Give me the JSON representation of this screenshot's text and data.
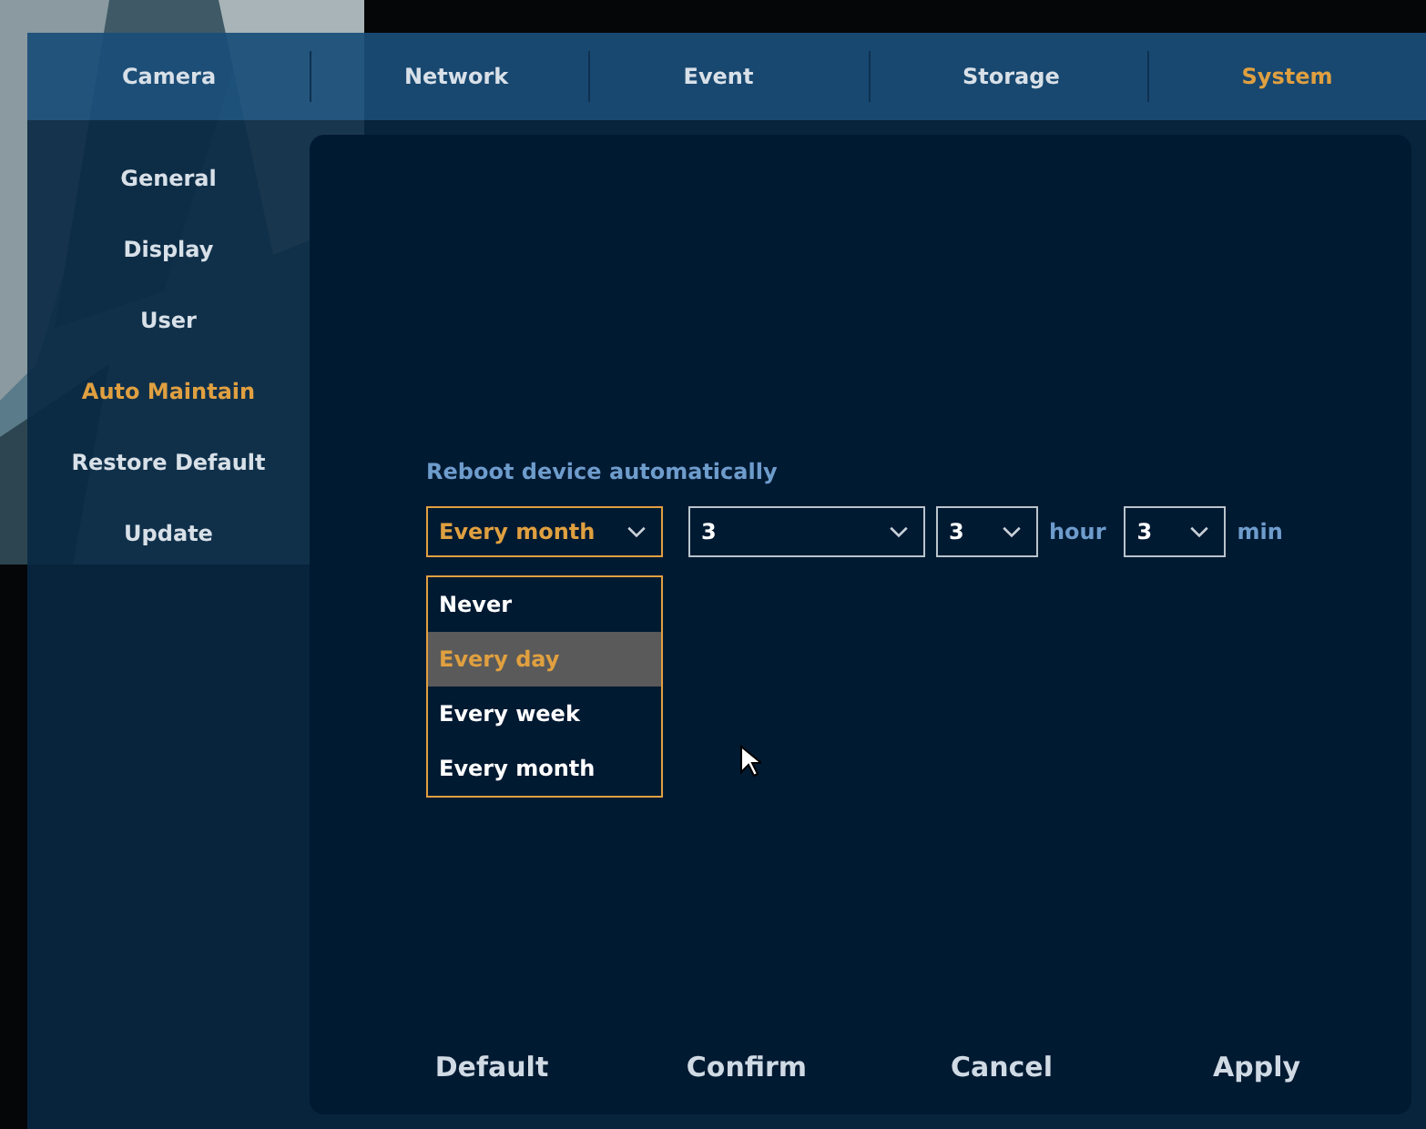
{
  "tabs": [
    {
      "label": "Camera",
      "selected": false
    },
    {
      "label": "Network",
      "selected": false
    },
    {
      "label": "Event",
      "selected": false
    },
    {
      "label": "Storage",
      "selected": false
    },
    {
      "label": "System",
      "selected": true
    }
  ],
  "sidebar": {
    "items": [
      {
        "label": "General",
        "selected": false
      },
      {
        "label": "Display",
        "selected": false
      },
      {
        "label": "User",
        "selected": false
      },
      {
        "label": "Auto Maintain",
        "selected": true
      },
      {
        "label": "Restore Default",
        "selected": false
      },
      {
        "label": "Update",
        "selected": false
      }
    ]
  },
  "reboot": {
    "label": "Reboot device automatically",
    "frequency": {
      "value": "Every month",
      "expanded": true,
      "options": [
        {
          "label": "Never",
          "highlighted": false
        },
        {
          "label": "Every day",
          "highlighted": true
        },
        {
          "label": "Every week",
          "highlighted": false
        },
        {
          "label": "Every month",
          "highlighted": false
        }
      ]
    },
    "day": {
      "value": "3"
    },
    "hour": {
      "value": "3",
      "unit": "hour"
    },
    "minute": {
      "value": "3",
      "unit": "min"
    }
  },
  "buttons": [
    "Default",
    "Confirm",
    "Cancel",
    "Apply"
  ]
}
